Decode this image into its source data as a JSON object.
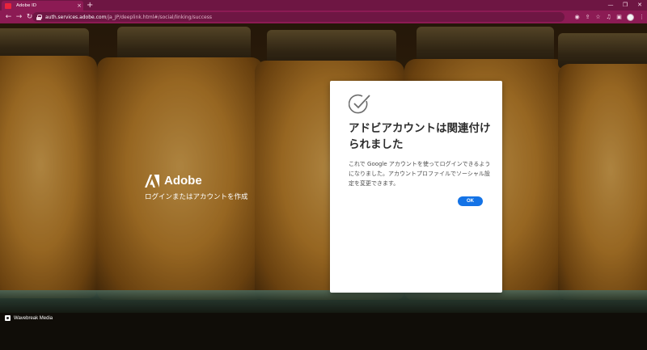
{
  "browser": {
    "tab_title": "Adobe ID",
    "tab_close": "×",
    "new_tab": "+",
    "url_host": "auth.services.adobe.com",
    "url_path": "/ja_JP/deeplink.html#/social/linking/success",
    "win_minimize": "—",
    "win_restore": "❐",
    "win_close": "✕",
    "nav_back": "←",
    "nav_forward": "→",
    "nav_reload": "↻",
    "icons": [
      "cast-icon",
      "share-icon",
      "star-icon",
      "media-icon",
      "sidepanel-icon",
      "profile-icon",
      "menu-icon"
    ]
  },
  "brand": {
    "name": "Adobe",
    "tagline": "ログインまたはアカウントを作成"
  },
  "dialog": {
    "title": "アドビアカウントは関連付けられました",
    "body": "これで Google アカウントを使ってログインできるようになりました。アカウントプロファイルでソーシャル設定を変更できます。",
    "ok_label": "OK"
  },
  "credit": {
    "text": "Wavebreak Media"
  },
  "colors": {
    "chrome_dark": "#6e1643",
    "chrome": "#8c1b54",
    "accent_blue": "#1473e6",
    "adobe_red": "#e8243c"
  }
}
